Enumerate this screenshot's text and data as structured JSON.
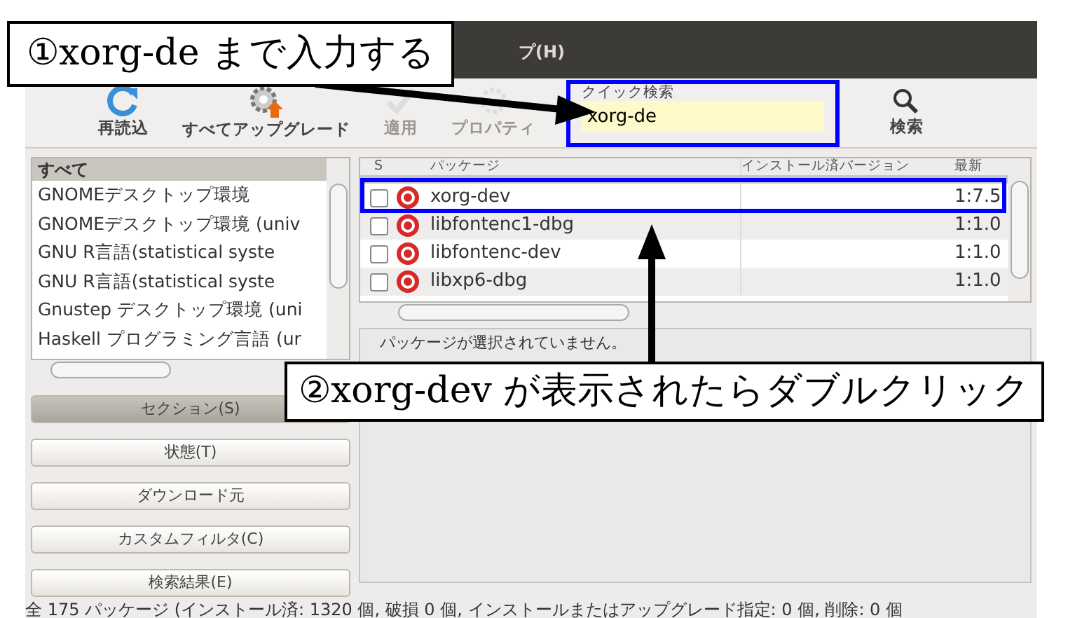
{
  "menubar": {
    "visible_text": "プ(H)"
  },
  "toolbar": [
    {
      "label": "再読込",
      "kind": "reload",
      "disabled": false
    },
    {
      "label": "すべてアップグレード",
      "kind": "upgrade",
      "disabled": false
    },
    {
      "label": "適用",
      "kind": "apply",
      "disabled": true
    },
    {
      "label": "プロパティ",
      "kind": "properties",
      "disabled": true
    }
  ],
  "quick_search": {
    "label": "クイック検索",
    "value": "xorg-de"
  },
  "search_button": {
    "label": "検索"
  },
  "sections": {
    "header": "すべて",
    "items": [
      "GNOMEデスクトップ環境",
      "GNOMEデスクトップ環境 (univ",
      "GNU R言語(statistical syste",
      "GNU R言語(statistical syste",
      "Gnustep デスクトップ環境 (uni",
      "Haskell プログラミング言語 (ur"
    ]
  },
  "filter_buttons": [
    {
      "label": "セクション(S)",
      "selected": true
    },
    {
      "label": "状態(T)",
      "selected": false
    },
    {
      "label": "ダウンロード元",
      "selected": false
    },
    {
      "label": "カスタムフィルタ(C)",
      "selected": false
    },
    {
      "label": "検索結果(E)",
      "selected": false
    }
  ],
  "table": {
    "columns": [
      "S",
      "パッケージ",
      "インストール済バージョン",
      "最新"
    ],
    "rows": [
      {
        "name": "xorg-dev",
        "installed": "",
        "latest": "1:7.5",
        "checked": false
      },
      {
        "name": "libfontenc1-dbg",
        "installed": "",
        "latest": "1:1.0",
        "checked": false
      },
      {
        "name": "libfontenc-dev",
        "installed": "",
        "latest": "1:1.0",
        "checked": false
      },
      {
        "name": "libxp6-dbg",
        "installed": "",
        "latest": "1:1.0",
        "checked": false
      }
    ]
  },
  "description": "パッケージが選択されていません。",
  "status_bar": "全 175 パッケージ (インストール済: 1320 個, 破損 0 個, インストールまたはアップグレード指定: 0 個, 削除: 0 個",
  "annotations": [
    {
      "text": "①xorg-de まで入力する"
    },
    {
      "text": "②xorg-dev が表示されたらダブルクリック"
    }
  ]
}
